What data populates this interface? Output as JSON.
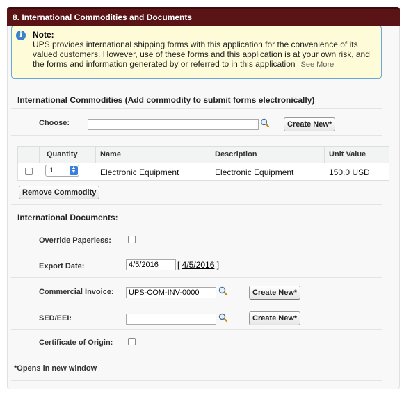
{
  "panel": {
    "title": "8. International Commodities and Documents"
  },
  "note": {
    "title": "Note:",
    "body": "UPS provides international shipping forms with this application for the convenience of its valued customers. However, use of these forms and this application is at your own risk, and the forms and information generated by or referred to in this application",
    "see_more": "See More"
  },
  "commodities": {
    "heading": "International Commodities (Add commodity to submit forms electronically)",
    "choose_label": "Choose:",
    "choose_value": "",
    "create_new_label": "Create New*",
    "columns": [
      "Quantity",
      "Name",
      "Description",
      "Unit Value"
    ],
    "rows": [
      {
        "quantity": "1",
        "name": "Electronic Equipment",
        "description": "Electronic Equipment",
        "unit_value": "150.0 USD"
      }
    ],
    "remove_label": "Remove Commodity"
  },
  "documents": {
    "heading": "International Documents:",
    "override_label": "Override Paperless:",
    "export_date_label": "Export Date:",
    "export_date_value": "4/5/2016",
    "export_date_link": "4/5/2016",
    "commercial_invoice_label": "Commercial Invoice:",
    "commercial_invoice_value": "UPS-COM-INV-0000",
    "sed_label": "SED/EEI:",
    "sed_value": "",
    "create_new_label": "Create New*",
    "certificate_label": "Certificate of Origin:"
  },
  "footnote": "*Opens in new window",
  "colors": {
    "header": "#5a1416",
    "note_bg": "#fdfbd8",
    "note_border": "#6aa7d8"
  },
  "icons": [
    "info-icon",
    "lookup-icon",
    "chevron-updown-icon"
  ]
}
